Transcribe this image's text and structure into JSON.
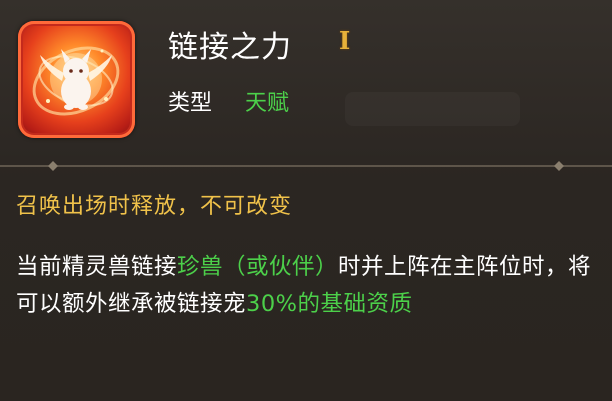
{
  "skill": {
    "name": "链接之力",
    "level": "I",
    "icon": "linked-beast-spirit-icon",
    "type_label": "类型",
    "type_value": "天赋"
  },
  "release_condition": "召唤出场时释放，不可改变",
  "description": {
    "part1": "当前精灵兽链接",
    "highlight1": "珍兽（或伙伴）",
    "part2": "时并上阵在主阵位时，将可以额外继承被链接宠",
    "highlight2": "30%的基础资质"
  },
  "colors": {
    "title": "#ffffff",
    "highlight_green": "#4cd04a",
    "release_gold": "#f0c24a",
    "level_gold": "#e8b23a",
    "panel_bg": "#2b2622"
  }
}
